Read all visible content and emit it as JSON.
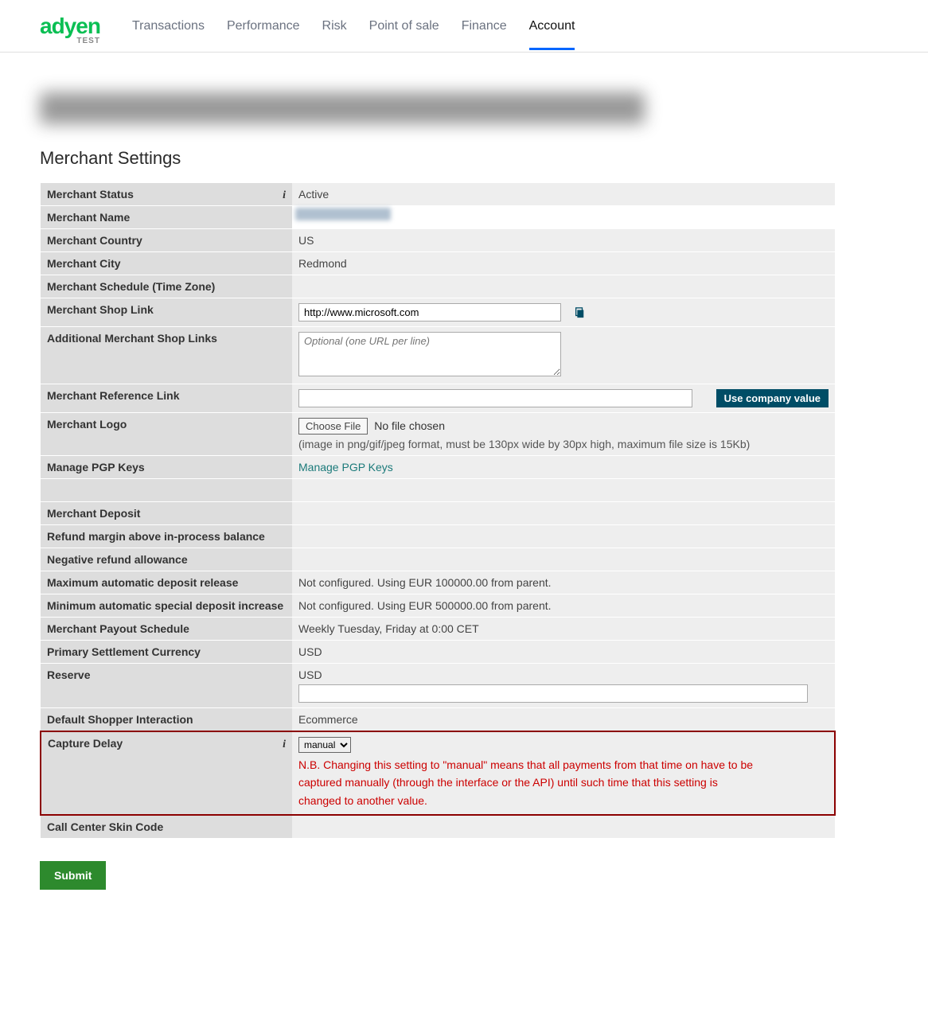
{
  "logo": {
    "text": "adyen",
    "sub": "TEST"
  },
  "nav": {
    "items": [
      {
        "label": "Transactions",
        "active": false
      },
      {
        "label": "Performance",
        "active": false
      },
      {
        "label": "Risk",
        "active": false
      },
      {
        "label": "Point of sale",
        "active": false
      },
      {
        "label": "Finance",
        "active": false
      },
      {
        "label": "Account",
        "active": true
      }
    ]
  },
  "section_title": "Merchant Settings",
  "labels": {
    "merchant_status": "Merchant Status",
    "merchant_name": "Merchant Name",
    "merchant_country": "Merchant Country",
    "merchant_city": "Merchant City",
    "merchant_schedule": "Merchant Schedule (Time Zone)",
    "merchant_shop_link": "Merchant Shop Link",
    "additional_links": "Additional Merchant Shop Links",
    "merchant_ref_link": "Merchant Reference Link",
    "merchant_logo": "Merchant Logo",
    "manage_pgp": "Manage PGP Keys",
    "merchant_deposit": "Merchant Deposit",
    "refund_margin": "Refund margin above in-process balance",
    "negative_refund": "Negative refund allowance",
    "max_auto_deposit": "Maximum automatic deposit release",
    "min_auto_special": "Minimum automatic special deposit increase",
    "payout_schedule": "Merchant Payout Schedule",
    "primary_currency": "Primary Settlement Currency",
    "reserve": "Reserve",
    "default_shopper": "Default Shopper Interaction",
    "capture_delay": "Capture Delay",
    "call_center": "Call Center Skin Code"
  },
  "values": {
    "merchant_status": "Active",
    "merchant_country": "US",
    "merchant_city": "Redmond",
    "merchant_shop_link": "http://www.microsoft.com",
    "additional_links_placeholder": "Optional (one URL per line)",
    "use_company_value": "Use company value",
    "choose_file": "Choose File",
    "no_file_chosen": "No file chosen",
    "logo_hint": "(image in png/gif/jpeg format, must be 130px wide by 30px high, maximum file size is 15Kb)",
    "manage_pgp_link": "Manage PGP Keys",
    "max_auto_deposit": "Not configured. Using EUR 100000.00 from parent.",
    "min_auto_special": "Not configured. Using EUR 500000.00 from parent.",
    "payout_schedule": "Weekly Tuesday, Friday at 0:00 CET",
    "primary_currency": "USD",
    "reserve": "USD",
    "default_shopper": "Ecommerce",
    "capture_delay_select": "manual",
    "capture_delay_warning": "N.B. Changing this setting to \"manual\" means that all payments from that time on have to be captured manually (through the interface or the API) until such time that this setting is changed to another value."
  },
  "submit_label": "Submit"
}
